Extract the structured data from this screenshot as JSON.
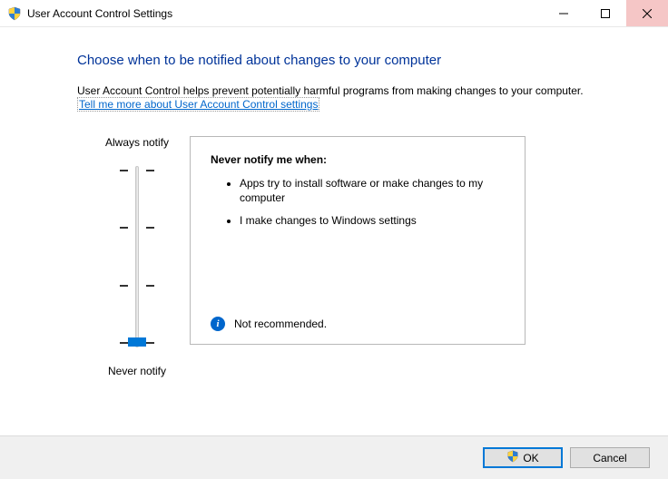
{
  "window": {
    "title": "User Account Control Settings"
  },
  "content": {
    "heading": "Choose when to be notified about changes to your computer",
    "subtext": "User Account Control helps prevent potentially harmful programs from making changes to your computer.",
    "help_link": "Tell me more about User Account Control settings"
  },
  "slider": {
    "top_label": "Always notify",
    "bottom_label": "Never notify",
    "levels": 4,
    "current_level": 0
  },
  "panel": {
    "heading": "Never notify me when:",
    "items": [
      "Apps try to install software or make changes to my computer",
      "I make changes to Windows settings"
    ],
    "footer_text": "Not recommended."
  },
  "buttons": {
    "ok": "OK",
    "cancel": "Cancel"
  }
}
